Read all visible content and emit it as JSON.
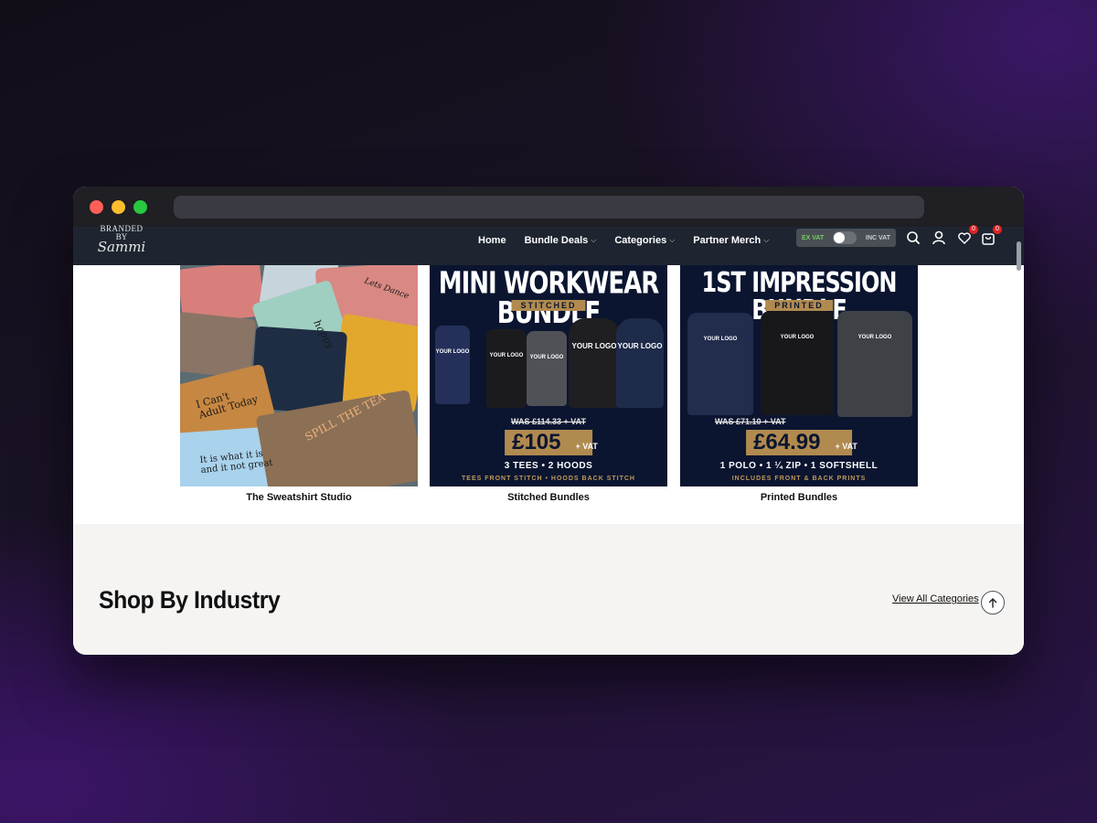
{
  "brand": {
    "logo_line1": "BRANDED",
    "logo_line2": "BY",
    "logo_line3": "Sammi"
  },
  "nav": {
    "items": [
      {
        "label": "Home",
        "has_dropdown": false
      },
      {
        "label": "Bundle Deals",
        "has_dropdown": true
      },
      {
        "label": "Categories",
        "has_dropdown": true
      },
      {
        "label": "Partner Merch",
        "has_dropdown": true
      }
    ]
  },
  "vat_toggle": {
    "ex_label": "EX VAT",
    "inc_label": "INC VAT"
  },
  "header_icons": {
    "search": "search-icon",
    "account": "user-icon",
    "wishlist": "heart-icon",
    "wishlist_count": "0",
    "cart": "bag-icon",
    "cart_count": "0"
  },
  "products": [
    {
      "caption": "The Sweatshirt Studio",
      "image_text": [
        "I Can't",
        "Adult Today",
        "It is what it is",
        "and it not great",
        "SPILL THE TEA",
        "Lets Dance",
        "happy"
      ]
    },
    {
      "caption": "Stitched Bundles",
      "image_title": "MINI WORKWEAR BUNDLE",
      "image_tag": "STITCHED",
      "image_was": "WAS £114.33 + VAT",
      "image_price": "£105",
      "image_price_suffix": "+ VAT",
      "image_items": "3 TEES • 2 HOODS",
      "image_note": "TEES FRONT STITCH • HOODS BACK STITCH",
      "garment_label_small": "YOUR LOGO",
      "garment_label_large": "YOUR LOGO"
    },
    {
      "caption": "Printed Bundles",
      "image_title": "1ST IMPRESSION BUNDLE",
      "image_tag": "PRINTED",
      "image_was": "WAS £71.10 + VAT",
      "image_price": "£64.99",
      "image_price_suffix": "+ VAT",
      "image_items": "1 POLO • 1 ¼ ZIP • 1 SOFTSHELL",
      "image_note": "INCLUDES FRONT & BACK PRINTS",
      "garment_label_small": "YOUR LOGO"
    }
  ],
  "industry": {
    "heading": "Shop By Industry",
    "view_all": "View All Categories"
  },
  "colors": {
    "header_bg": "#1e2530",
    "bundle_bg": "#0b1530",
    "gold": "#b08a4f",
    "section_bg": "#f6f4f2",
    "badge": "#e02424"
  }
}
